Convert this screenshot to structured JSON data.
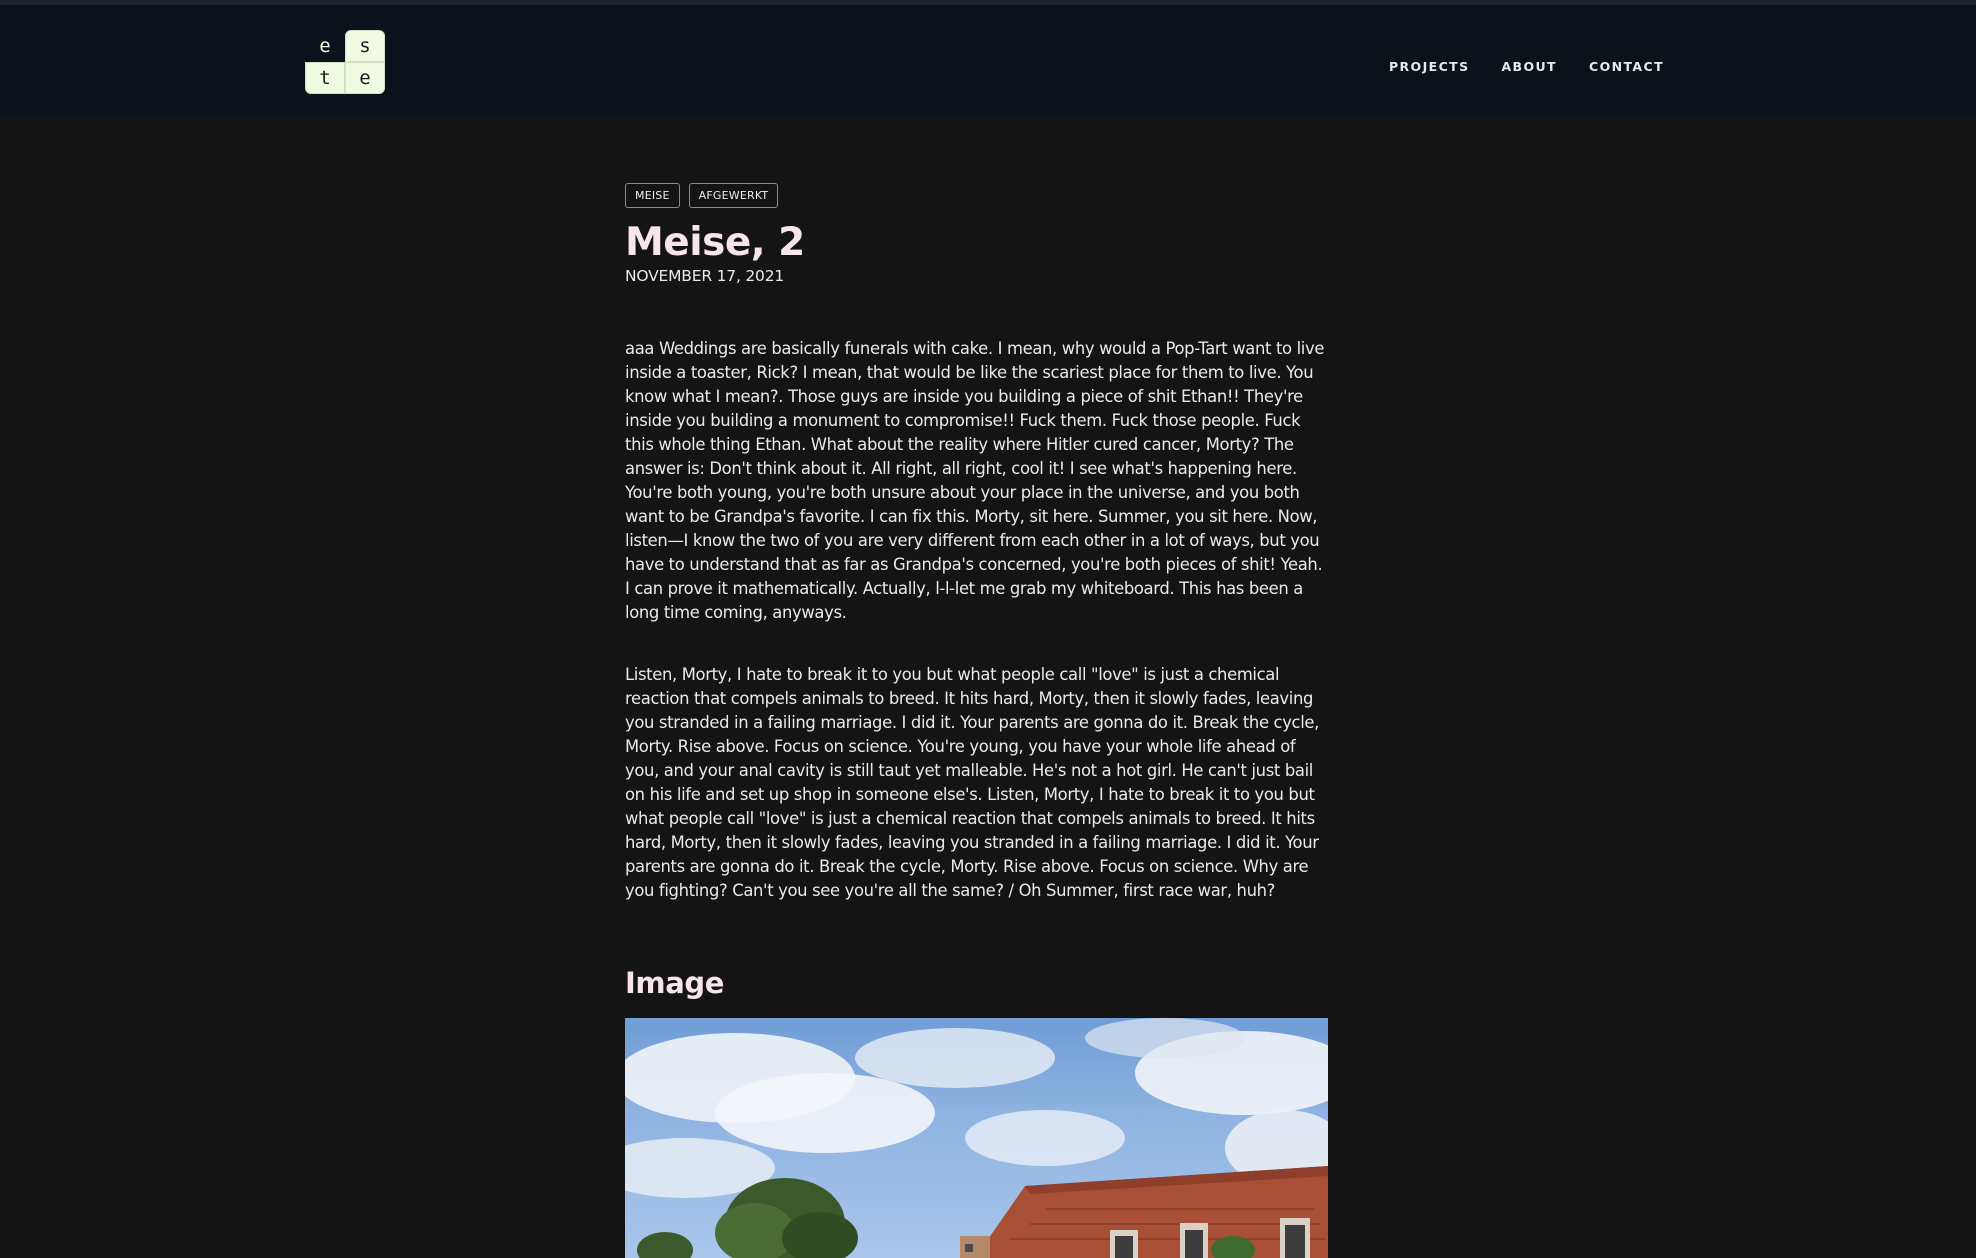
{
  "header": {
    "logo": {
      "letters": [
        "e",
        "s",
        "t",
        "e"
      ]
    },
    "nav": [
      {
        "label": "PROJECTS"
      },
      {
        "label": "ABOUT"
      },
      {
        "label": "CONTACT"
      }
    ]
  },
  "post": {
    "tags": [
      {
        "label": "MEISE"
      },
      {
        "label": "AFGEWERKT"
      }
    ],
    "title": "Meise, 2",
    "date": "NOVEMBER 17, 2021",
    "paragraphs": [
      "aaa Weddings are basically funerals with cake. I mean, why would a Pop-Tart want to live inside a toaster, Rick? I mean, that would be like the scariest place for them to live. You know what I mean?. Those guys are inside you building a piece of shit Ethan!! They're inside you building a monument to compromise!! Fuck them. Fuck those people. Fuck this whole thing Ethan. What about the reality where Hitler cured cancer, Morty? The answer is: Don't think about it. All right, all right, cool it! I see what's happening here. You're both young, you're both unsure about your place in the universe, and you both want to be Grandpa's favorite. I can fix this. Morty, sit here. Summer, you sit here. Now, listen—I know the two of you are very different from each other in a lot of ways, but you have to understand that as far as Grandpa's concerned, you're both pieces of shit! Yeah. I can prove it mathematically. Actually, l-l-let me grab my whiteboard. This has been a long time coming, anyways.",
      "Listen, Morty, I hate to break it to you but what people call \"love\" is just a chemical reaction that compels animals to breed. It hits hard, Morty, then it slowly fades, leaving you stranded in a failing marriage. I did it. Your parents are gonna do it. Break the cycle, Morty. Rise above. Focus on science. You're young, you have your whole life ahead of you, and your anal cavity is still taut yet malleable. He's not a hot girl. He can't just bail on his life and set up shop in someone else's. Listen, Morty, I hate to break it to you but what people call \"love\" is just a chemical reaction that compels animals to breed. It hits hard, Morty, then it slowly fades, leaving you stranded in a failing marriage. I did it. Your parents are gonna do it. Break the cycle, Morty. Rise above. Focus on science. Why are you fighting? Can't you see you're all the same? / Oh Summer, first race war, huh?"
    ],
    "section_title": "Image"
  },
  "colors": {
    "page_bg": "#141414",
    "header_bg": "#0b1219",
    "logo_tile": "#f0fae0",
    "title_text": "#f7e5ea",
    "body_text": "#ece9ec"
  }
}
